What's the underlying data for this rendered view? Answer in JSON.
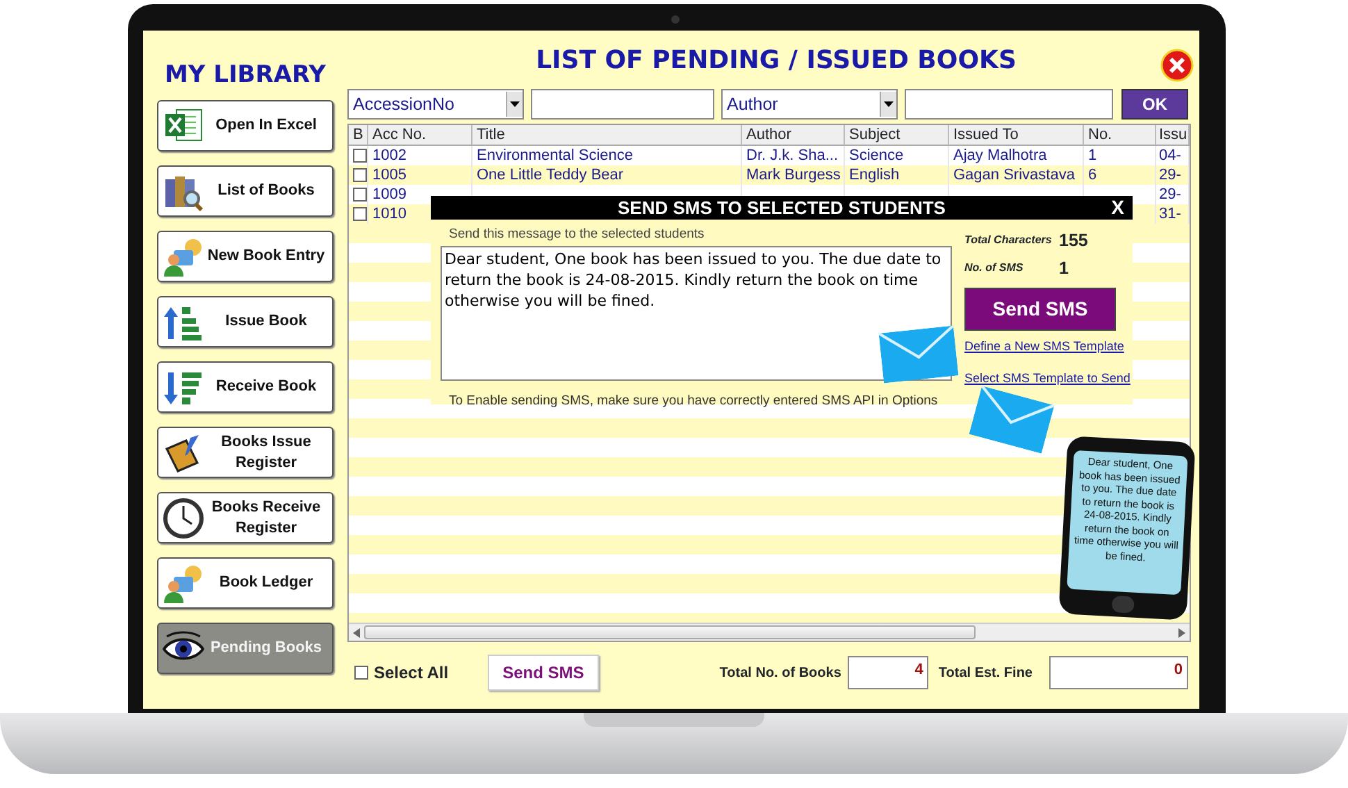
{
  "sidebar": {
    "title": "MY LIBRARY",
    "items": [
      {
        "label": "Open In Excel",
        "kind": "excel",
        "selected": false
      },
      {
        "label": "List of Books",
        "kind": "books",
        "selected": false
      },
      {
        "label": "New Book Entry",
        "kind": "people",
        "selected": false
      },
      {
        "label": "Issue Book",
        "kind": "issue",
        "selected": false
      },
      {
        "label": "Receive Book",
        "kind": "receive",
        "selected": false
      },
      {
        "label": "Books Issue Register",
        "kind": "notebook",
        "selected": false
      },
      {
        "label": "Books Receive Register",
        "kind": "clock",
        "selected": false
      },
      {
        "label": "Book Ledger",
        "kind": "people",
        "selected": false
      },
      {
        "label": "Pending Books",
        "kind": "eye",
        "selected": true
      }
    ]
  },
  "header": {
    "title": "LIST OF PENDING / ISSUED  BOOKS"
  },
  "filters": [
    {
      "kind": "select",
      "value": "AccessionNo"
    },
    {
      "kind": "input"
    },
    {
      "kind": "select",
      "value": "Author"
    },
    {
      "kind": "input"
    }
  ],
  "ok_button": "OK",
  "table": {
    "columns": [
      "B",
      "Acc No.",
      "Title",
      "Author",
      "Subject",
      "Issued To",
      "No.",
      "Issu"
    ],
    "rows": [
      {
        "cells": [
          {
            "checked": false
          },
          "1002",
          "Environmental Science",
          "Dr. J.k. Sha...",
          "Science",
          "Ajay Malhotra",
          "1",
          "04-"
        ]
      },
      {
        "cells": [
          {
            "checked": false
          },
          "1005",
          "One Little Teddy Bear",
          "Mark Burgess",
          "English",
          "Gagan Srivastava",
          "6",
          "29-"
        ]
      },
      {
        "cells": [
          {
            "checked": false
          },
          "1009",
          "",
          "",
          "",
          "",
          "",
          "29-"
        ]
      },
      {
        "cells": [
          {
            "checked": false
          },
          "1010",
          "",
          "",
          "",
          "",
          "",
          "31-"
        ]
      }
    ]
  },
  "sms_dialog": {
    "title": "SEND SMS TO SELECTED STUDENTS",
    "close": "X",
    "prompt": "Send this message to the selected students",
    "message": "Dear student, One book has been issued to you. The due date to return the book is 24-08-2015. Kindly return the book on time otherwise you will be fined.",
    "total_characters_label": "Total Characters",
    "total_characters": "155",
    "sms_count_label": "No. of SMS",
    "sms_count": "1",
    "send_button": "Send SMS",
    "links": [
      "Define a New SMS Template",
      "Select SMS Template to Send"
    ],
    "note": "To Enable sending SMS, make sure you have correctly entered SMS API in Options"
  },
  "footer": {
    "select_all": {
      "label": "Select All",
      "checked": false
    },
    "send_button": "Send SMS",
    "total_books_label": "Total No. of Books",
    "total_books": "4",
    "total_fine_label": "Total Est. Fine",
    "total_fine": "0"
  },
  "phone": {
    "message": "Dear student, One book has been issued to you. The due date to return the book is 24-08-2015. Kindly return the book on time otherwise you will be fined."
  }
}
